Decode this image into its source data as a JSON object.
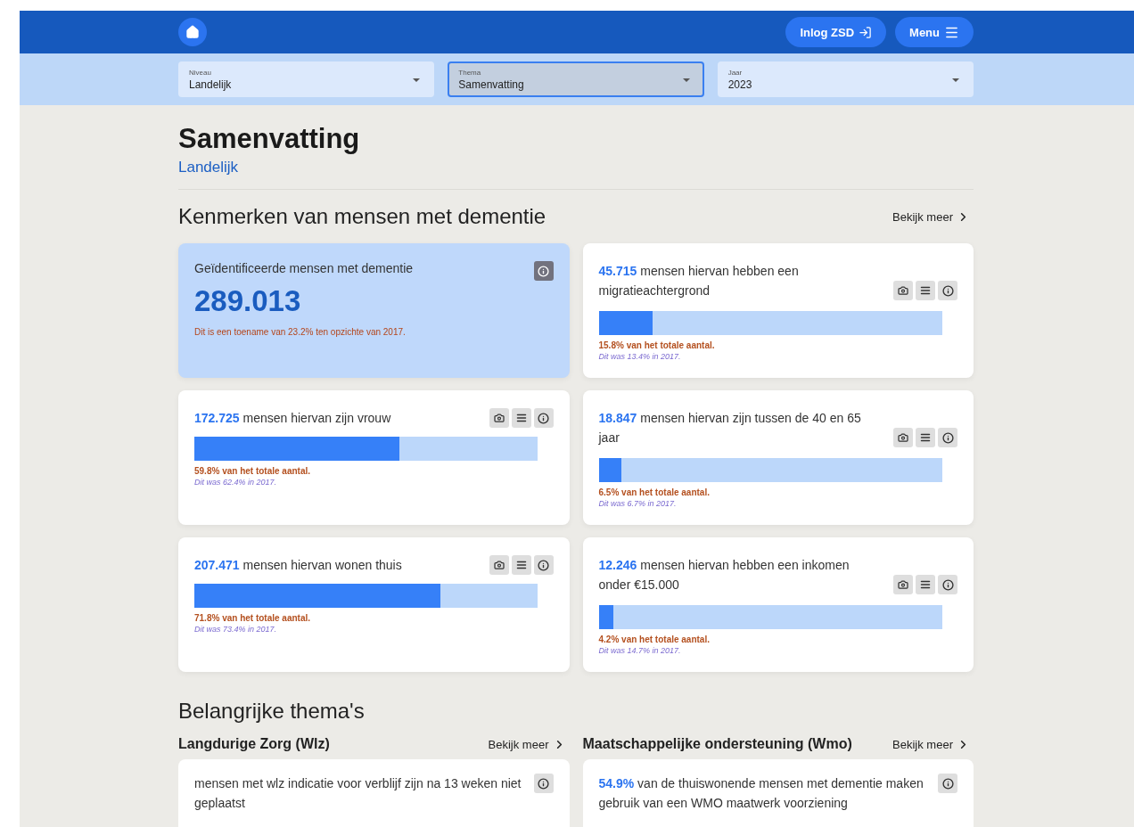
{
  "header": {
    "login_button": "Inlog ZSD",
    "menu_button": "Menu"
  },
  "filters": [
    {
      "label": "Niveau",
      "value": "Landelijk",
      "focused": false
    },
    {
      "label": "Thema",
      "value": "Samenvatting",
      "focused": true
    },
    {
      "label": "Jaar",
      "value": "2023",
      "focused": false
    }
  ],
  "page": {
    "title": "Samenvatting",
    "subtitle": "Landelijk"
  },
  "section": {
    "title": "Kenmerken van mensen met dementie",
    "more_link": "Bekijk meer",
    "cards": [
      {
        "kind": "highlight",
        "title": "Geïdentificeerde mensen met dementie",
        "number": "289.013",
        "note": "Dit is een toename van 23.2% ten opzichte van 2017."
      },
      {
        "kind": "bar",
        "text": "**45.715** mensen hiervan hebben een migratieachtergrond",
        "level": 0.158,
        "share": "15.8% van het totale aantal.",
        "previous": "Dit was 13.4% in 2017."
      },
      {
        "kind": "bar",
        "text": "**172.725** mensen hiervan zijn vrouw",
        "level": 0.598,
        "share": "59.8% van het totale aantal.",
        "previous": "Dit was 62.4% in 2017."
      },
      {
        "kind": "bar",
        "text": "**18.847** mensen hiervan zijn tussen de 40 en 65 jaar",
        "level": 0.065,
        "share": "6.5% van het totale aantal.",
        "previous": "Dit was 6.7% in 2017."
      },
      {
        "kind": "bar",
        "text": "**207.471** mensen hiervan wonen thuis",
        "level": 0.718,
        "share": "71.8% van het totale aantal.",
        "previous": "Dit was 73.4% in 2017."
      },
      {
        "kind": "bar",
        "text": "**12.246** mensen hiervan hebben een inkomen onder €15.000",
        "level": 0.042,
        "share": "4.2% van het totale aantal.",
        "previous": "Dit was 14.7% in 2017."
      }
    ]
  },
  "themes": {
    "title": "Belangrijke thema's",
    "columns": [
      {
        "title": "Langdurige Zorg (Wlz)",
        "more_link": "Bekijk meer",
        "text": "mensen met wlz indicatie voor verblijf zijn na 13 weken niet geplaatst"
      },
      {
        "title": "Maatschappelijke ondersteuning (Wmo)",
        "more_link": "Bekijk meer",
        "text": "**54.9%** van de thuiswonende mensen met dementie maken gebruik van een WMO maatwerk voorziening"
      }
    ]
  }
}
